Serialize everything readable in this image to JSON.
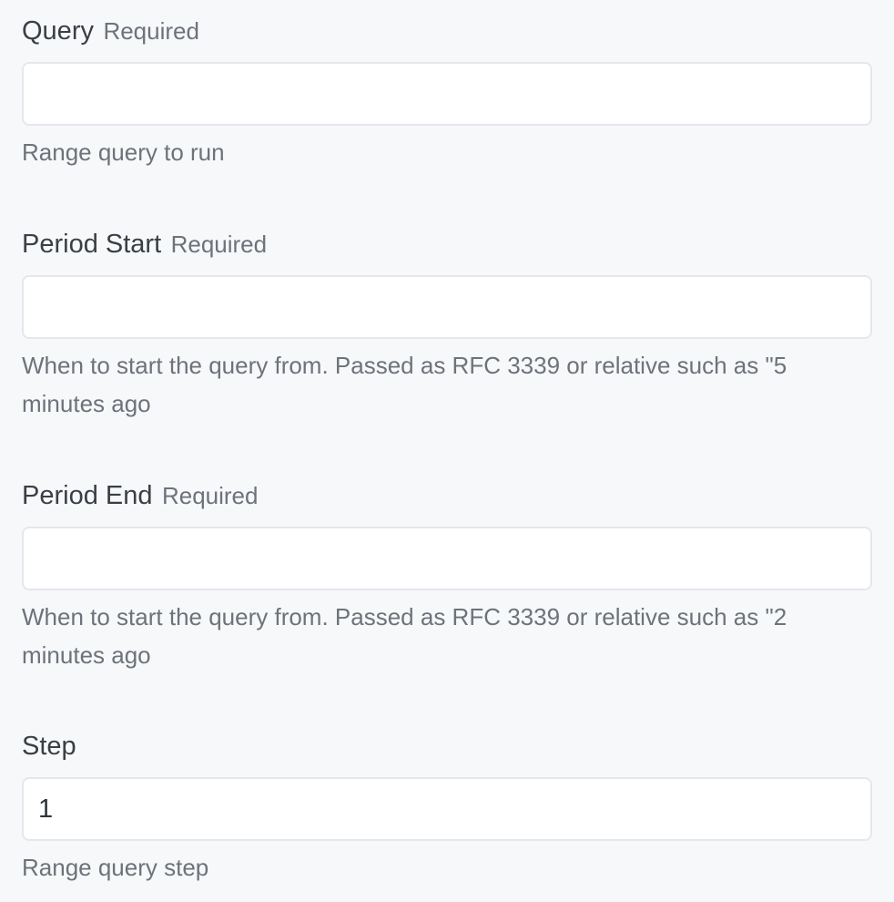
{
  "fields": {
    "query": {
      "label": "Query",
      "required_text": "Required",
      "value": "",
      "help": "Range query to run"
    },
    "period_start": {
      "label": "Period Start",
      "required_text": "Required",
      "value": "",
      "help": "When to start the query from. Passed as RFC 3339 or relative such as \"5 minutes ago"
    },
    "period_end": {
      "label": "Period End",
      "required_text": "Required",
      "value": "",
      "help": "When to start the query from. Passed as RFC 3339 or relative such as \"2 minutes ago"
    },
    "step": {
      "label": "Step",
      "value": "1",
      "help": "Range query step"
    }
  }
}
